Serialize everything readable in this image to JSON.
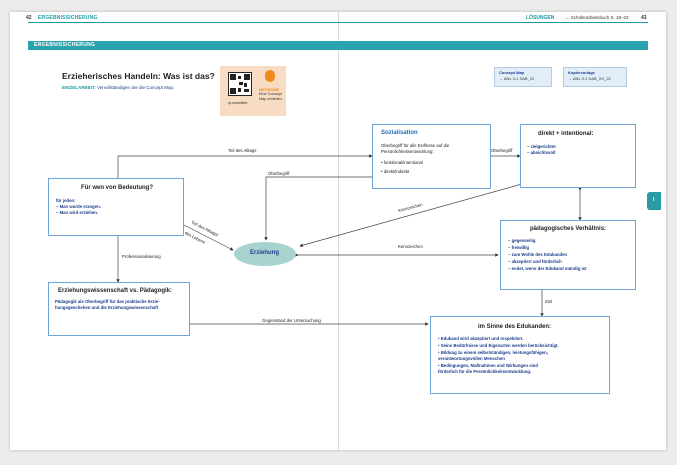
{
  "header": {
    "page_left": "42",
    "running_left": "ERGEBNISSICHERUNG",
    "running_right": "LÖSUNGEN",
    "running_right_ref": "→ Schülerarbeitsbuch S. 18–23",
    "page_right": "43"
  },
  "band_title": "ERGEBNISSICHERUNG",
  "side_tab": "I",
  "title": "Erzieherisches Handeln: Was ist das?",
  "task": {
    "label": "EINZELARBEIT:",
    "text": "Vervollständigen Sie die Concept Map."
  },
  "method": {
    "caption": "qr.rolandfeld",
    "label": "METHODE",
    "text": "Eine Concept Map erstellen"
  },
  "refs": [
    {
      "title": "Concept Map",
      "code": "→ ANL 3-1 SAB_22"
    },
    {
      "title": "Kopiervorlage",
      "code": "→ ANL 3-1 SAB_XX_22"
    }
  ],
  "boxes": {
    "bedeutung": {
      "title": "Für wen von Bedeutung?",
      "lines": [
        "für jeden:",
        "– Man wurde erzogen.",
        "– Man wird erziehen."
      ]
    },
    "sozialisation": {
      "title": "Sozialisation",
      "lines": [
        "Oberbegriff für alle Einflüsse auf die",
        "Persönlichkeitsentwicklung:",
        "• funktional/intentional",
        "• direkt/indirekt"
      ]
    },
    "direkt": {
      "title": "direkt + intentional:",
      "lines": [
        "– zielgerichtet",
        "– absichtsvoll"
      ]
    },
    "paedag": {
      "title": "pädagogisches Verhältnis:",
      "lines": [
        "– gegenseitig",
        "– freiwillig",
        "– zum Wohle des Edukanden",
        "– akzeptiert und förderlich",
        "– endet, wenn der Edukand mündig ist"
      ]
    },
    "wissenschaft": {
      "title": "Erziehungswissenschaft vs. Pädagogik:",
      "lines": [
        "Pädagogik als Oberbegriff für das praktische Erzie-",
        "hungsgeschehen und die Erziehungswissenschaft"
      ]
    },
    "sinne": {
      "title": "im Sinne des Edukanden:",
      "lines": [
        "• Edukand wird akzeptiert und respektiert.",
        "• Seine Bedürfnisse und Eigenarten werden berücksichtigt.",
        "• Bildung zu einem selbstständigen, leistungsfähigen,",
        "   verantwortungsvollen Menschen",
        "• Bedingungen, Maßnahmen und Wirkungen sind",
        "   förderlich für die Persönlichkeitsentwicklung."
      ]
    }
  },
  "center": "Erziehung",
  "labels": {
    "teil_alltags_top": "Teil des Alltags",
    "oberbegriff_left": "Oberbegriff",
    "oberbegriff_right": "Oberbegriff",
    "kennzeichen_diag": "Kennzeichen",
    "kennzeichen_mid": "Kennzeichen",
    "teil_diag_1": "Teil des Alltags/",
    "teil_diag_2": "des Lebens",
    "professional": "Professionalisierung",
    "ziel": "Ziel",
    "gegenstand": "Gegenstand der Untersuchung"
  }
}
